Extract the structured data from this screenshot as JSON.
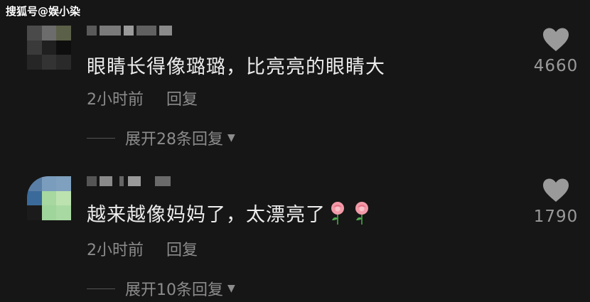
{
  "watermark": "搜狐号@娱小染",
  "comments": [
    {
      "text": "眼睛长得像璐璐，比亮亮的眼睛大",
      "time": "2小时前",
      "reply_label": "回复",
      "expand_label": "展开28条回复",
      "likes": "4660",
      "liked": false,
      "avatar_icon": "user-avatar-icon",
      "colors": {
        "text": "#ececec",
        "meta": "#8c8c8c"
      }
    },
    {
      "text": "越来越像妈妈了，太漂亮了",
      "emoji": [
        "rose-emoji",
        "rose-emoji"
      ],
      "time": "2小时前",
      "reply_label": "回复",
      "expand_label": "展开10条回复",
      "likes": "1790",
      "liked": false,
      "avatar_icon": "user-avatar-icon",
      "colors": {
        "text": "#ececec",
        "meta": "#8c8c8c"
      }
    }
  ],
  "icons": {
    "like": "heart-icon",
    "expand": "triangle-down-icon"
  },
  "theme": {
    "background": "#161616",
    "heart": "#9a9a9a"
  }
}
